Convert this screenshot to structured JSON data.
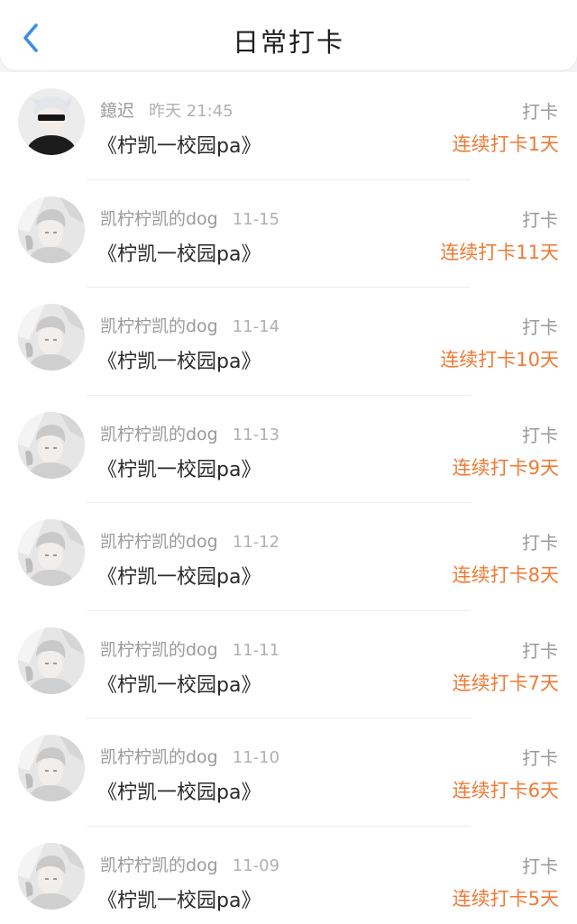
{
  "header": {
    "title": "日常打卡",
    "back_icon": "chevron-left-icon",
    "accent_color": "#3a8ee6"
  },
  "colors": {
    "streak": "#f07a35",
    "muted": "#9a9a9a"
  },
  "items": [
    {
      "user": "鐿迟",
      "date": "昨天 21:45",
      "topic": "《柠凯一校园pa》",
      "action": "打卡",
      "streak": "连续打卡1天",
      "avatar": "avatar-a"
    },
    {
      "user": "凯柠柠凯的dog",
      "date": "11-15",
      "topic": "《柠凯一校园pa》",
      "action": "打卡",
      "streak": "连续打卡11天",
      "avatar": "avatar-b"
    },
    {
      "user": "凯柠柠凯的dog",
      "date": "11-14",
      "topic": "《柠凯一校园pa》",
      "action": "打卡",
      "streak": "连续打卡10天",
      "avatar": "avatar-b"
    },
    {
      "user": "凯柠柠凯的dog",
      "date": "11-13",
      "topic": "《柠凯一校园pa》",
      "action": "打卡",
      "streak": "连续打卡9天",
      "avatar": "avatar-b"
    },
    {
      "user": "凯柠柠凯的dog",
      "date": "11-12",
      "topic": "《柠凯一校园pa》",
      "action": "打卡",
      "streak": "连续打卡8天",
      "avatar": "avatar-b"
    },
    {
      "user": "凯柠柠凯的dog",
      "date": "11-11",
      "topic": "《柠凯一校园pa》",
      "action": "打卡",
      "streak": "连续打卡7天",
      "avatar": "avatar-b"
    },
    {
      "user": "凯柠柠凯的dog",
      "date": "11-10",
      "topic": "《柠凯一校园pa》",
      "action": "打卡",
      "streak": "连续打卡6天",
      "avatar": "avatar-b"
    },
    {
      "user": "凯柠柠凯的dog",
      "date": "11-09",
      "topic": "《柠凯一校园pa》",
      "action": "打卡",
      "streak": "连续打卡5天",
      "avatar": "avatar-b"
    }
  ]
}
